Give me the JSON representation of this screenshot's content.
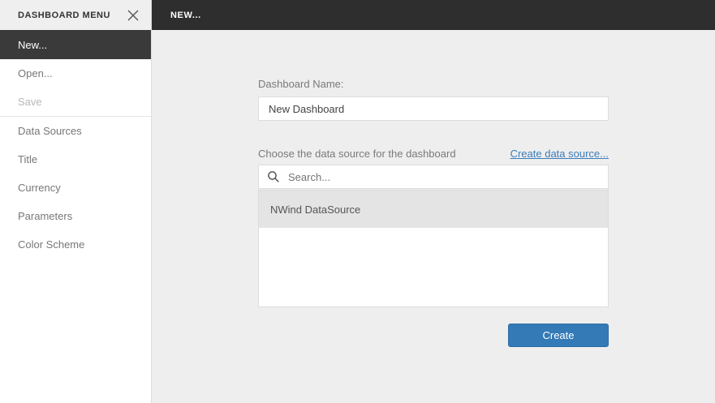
{
  "colors": {
    "topbar_bg": "#2e2e2e",
    "selected_menu_bg": "#3a3a3a",
    "content_bg": "#eeeeee",
    "selected_row_bg": "#e4e4e4",
    "link_blue": "#3d7cb9",
    "button_blue": "#337ab7"
  },
  "topbar": {
    "title": "NEW..."
  },
  "sidebar": {
    "header": {
      "title": "DASHBOARD MENU",
      "close_icon": "close-icon"
    },
    "items": [
      {
        "label": "New...",
        "state": "selected"
      },
      {
        "label": "Open...",
        "state": "normal"
      },
      {
        "label": "Save",
        "state": "disabled"
      },
      {
        "label": "Data Sources",
        "state": "normal"
      },
      {
        "label": "Title",
        "state": "normal"
      },
      {
        "label": "Currency",
        "state": "normal"
      },
      {
        "label": "Parameters",
        "state": "normal"
      },
      {
        "label": "Color Scheme",
        "state": "normal"
      }
    ]
  },
  "main": {
    "dashboard_name": {
      "label": "Dashboard Name:",
      "value": "New Dashboard"
    },
    "data_source": {
      "label": "Choose the data source for the dashboard",
      "create_link": "Create data source...",
      "search": {
        "placeholder": "Search...",
        "icon": "search-icon"
      },
      "items": [
        {
          "name": "NWind DataSource",
          "selected": true
        }
      ]
    },
    "create_button_label": "Create"
  }
}
